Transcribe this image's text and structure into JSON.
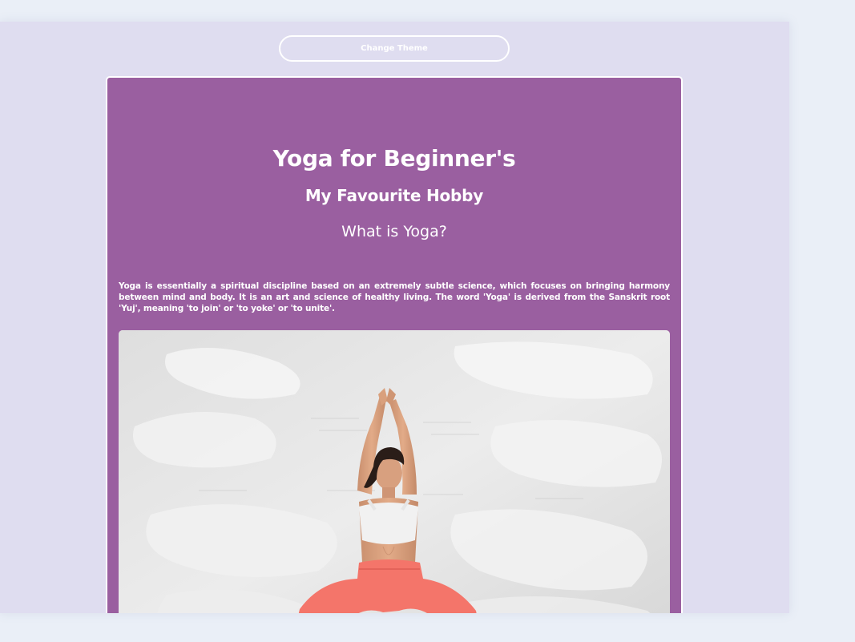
{
  "theme_button": {
    "label": "Change Theme"
  },
  "header": {
    "title": "Yoga for Beginner's",
    "subtitle": "My Favourite Hobby",
    "question": "What is Yoga?"
  },
  "content": {
    "intro": "Yoga is essentially a spiritual discipline based on an extremely subtle science, which focuses on bringing harmony between mind and body. It is an art and science of healthy living. The word 'Yoga' is derived from the Sanskrit root 'Yuj', meaning 'to join' or 'to yoke' or 'to unite'."
  },
  "colors": {
    "page_background": "#eaeff7",
    "viewport_background": "#dfddf0",
    "card_background": "#9a5fa0",
    "text": "#ffffff",
    "leggings": "#f4756a"
  }
}
